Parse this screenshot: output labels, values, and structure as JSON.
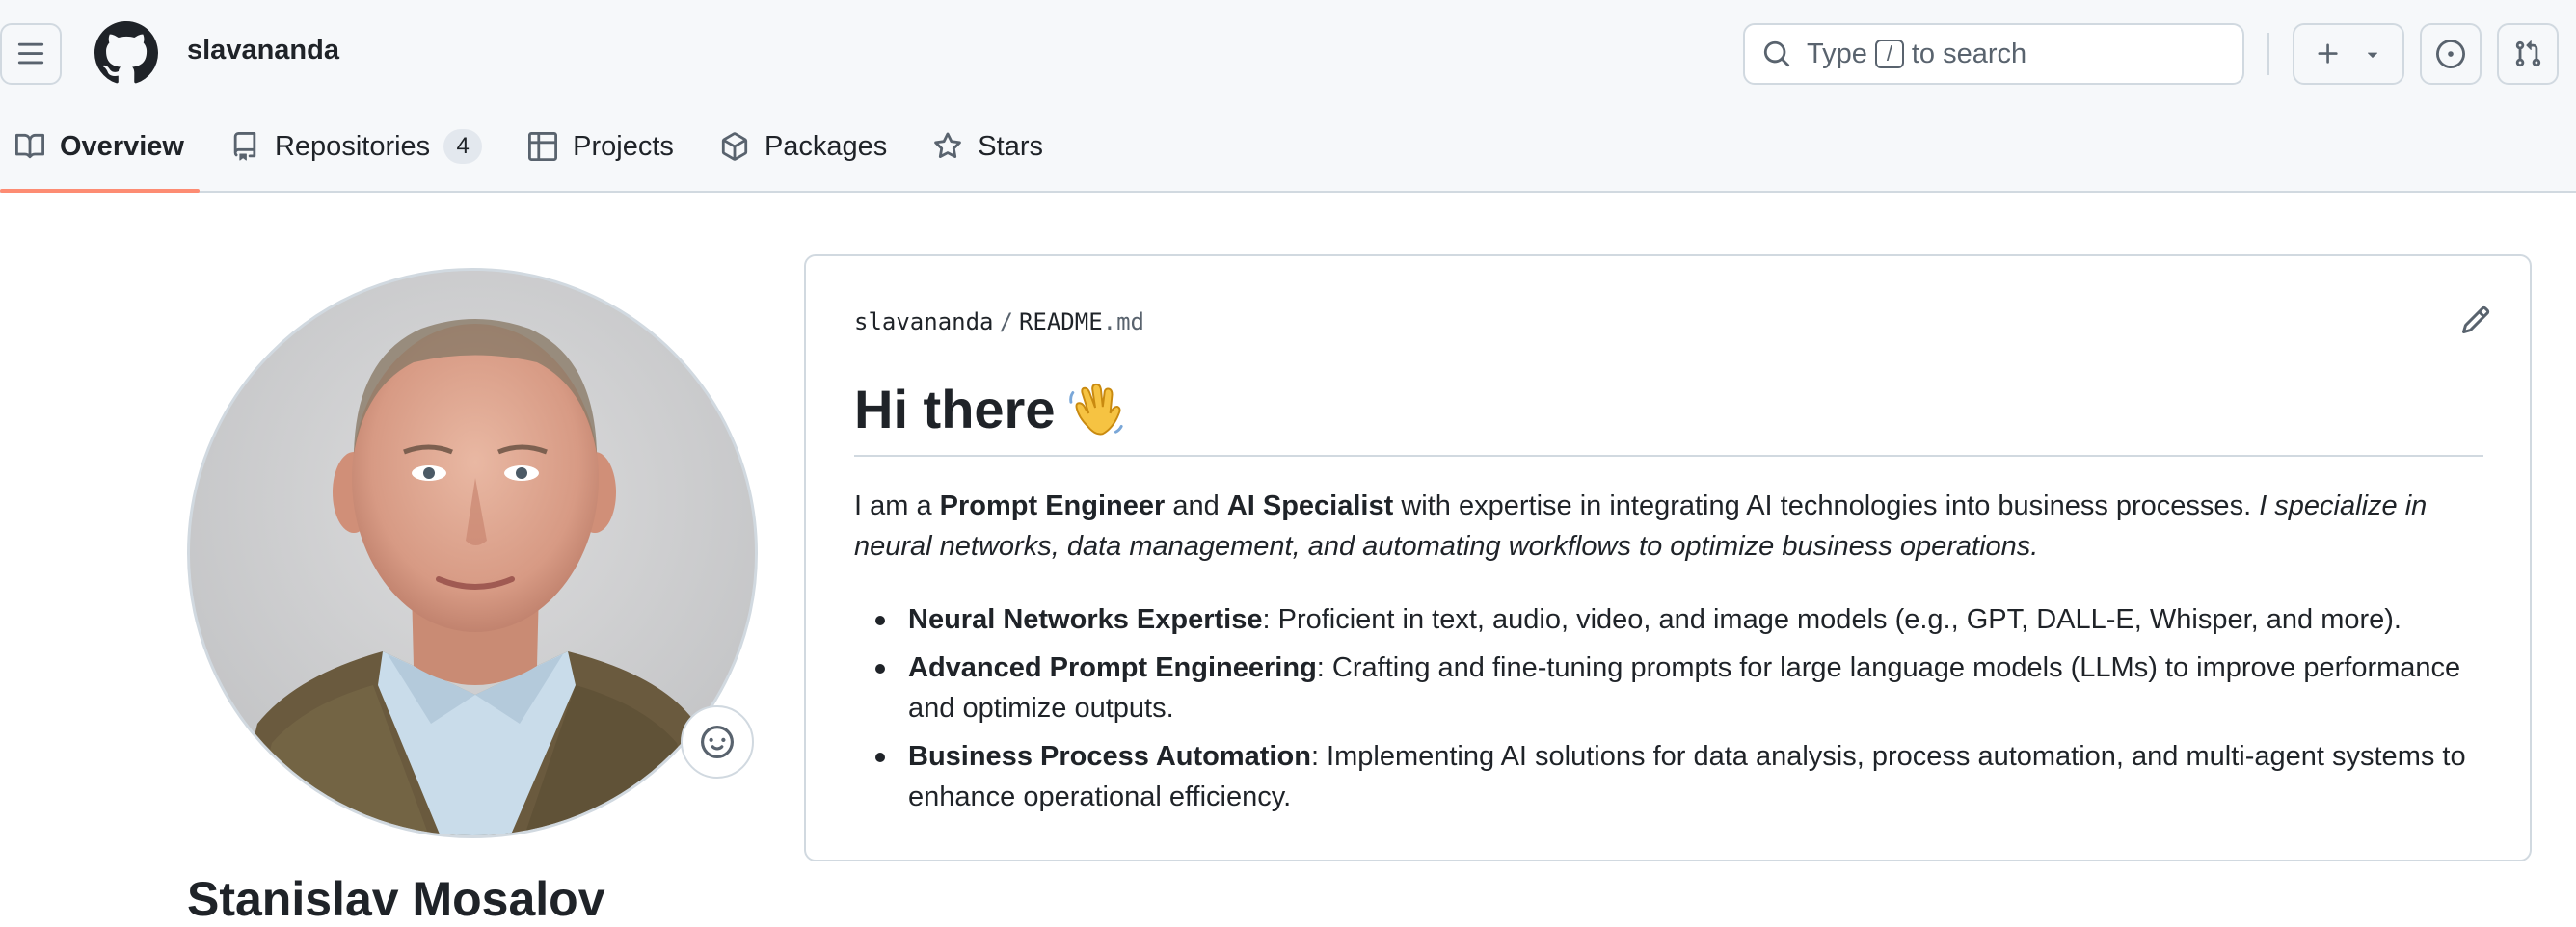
{
  "header": {
    "username": "slavananda",
    "search": {
      "pre": "Type",
      "key": "/",
      "post": "to search"
    },
    "icons": [
      "hamburger-icon",
      "github-logo-icon",
      "search-icon",
      "plus-icon",
      "caret-down-icon",
      "issues-icon",
      "pull-request-icon"
    ]
  },
  "tabs": [
    {
      "label": "Overview",
      "icon": "book-icon",
      "active": true
    },
    {
      "label": "Repositories",
      "icon": "repo-icon",
      "count": "4"
    },
    {
      "label": "Projects",
      "icon": "table-icon"
    },
    {
      "label": "Packages",
      "icon": "package-icon"
    },
    {
      "label": "Stars",
      "icon": "star-icon"
    }
  ],
  "profile": {
    "name": "Stanislav Mosalov"
  },
  "readme": {
    "path_owner": "slavananda",
    "path_sep": "/",
    "path_file": "README",
    "path_ext": ".md",
    "title": "Hi there",
    "intro": {
      "p1": "I am a ",
      "b1": "Prompt Engineer",
      "p2": " and ",
      "b2": "AI Specialist",
      "p3": " with expertise in integrating AI technologies into business processes. ",
      "italic": "I specialize in neural networks, data management, and automating workflows to optimize business operations."
    },
    "items": [
      {
        "bold": "Neural Networks Expertise",
        "text": ": Proficient in text, audio, video, and image models (e.g., GPT, DALL-E, Whisper, and more)."
      },
      {
        "bold": "Advanced Prompt Engineering",
        "text": ": Crafting and fine-tuning prompts for large language models (LLMs) to improve performance and optimize outputs."
      },
      {
        "bold": "Business Process Automation",
        "text": ": Implementing AI solutions for data analysis, process automation, and multi-agent systems to enhance operational efficiency."
      }
    ]
  },
  "colors": {
    "accent_underline": "#fd8c73",
    "header_bg": "#f6f8fa",
    "border": "#d1d9e0",
    "text": "#1f2328",
    "muted": "#59636e"
  }
}
